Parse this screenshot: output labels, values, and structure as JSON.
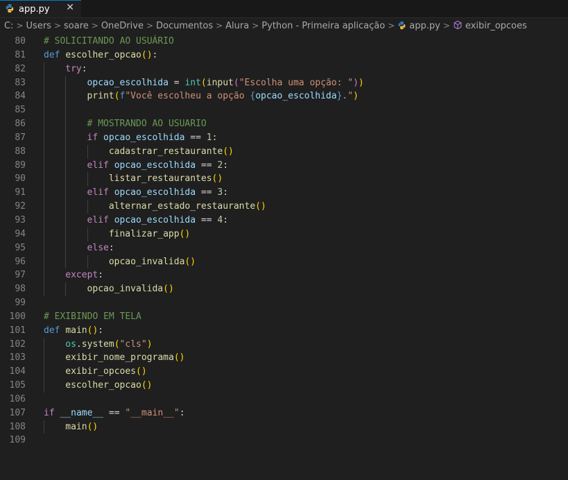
{
  "tab": {
    "filename": "app.py",
    "close_glyph": "✕"
  },
  "breadcrumb": {
    "segments": [
      "C:",
      "Users",
      "soare",
      "OneDrive",
      "Documentos",
      "Alura",
      "Python - Primeira aplicação",
      "app.py",
      "exibir_opcoes"
    ],
    "separator": ">"
  },
  "colors": {
    "comment": "#6a9955",
    "keyword": "#c586c0",
    "def": "#569cd6",
    "function": "#dcdcaa",
    "variable": "#9cdcfe",
    "string": "#ce9178",
    "number": "#b5cea8",
    "builtin": "#4ec9b0",
    "bracket1": "#ffd700",
    "bracket2": "#da70d6",
    "plain": "#d4d4d4"
  },
  "editor": {
    "lines": [
      {
        "n": "80",
        "indent": 0,
        "tokens": [
          [
            "cm",
            "# SOLICITANDO AO USUÁRIO"
          ]
        ]
      },
      {
        "n": "81",
        "indent": 0,
        "tokens": [
          [
            "kd",
            "def"
          ],
          [
            "pl",
            " "
          ],
          [
            "fn",
            "escolher_opcao"
          ],
          [
            "p1",
            "()"
          ],
          [
            "pl",
            ":"
          ]
        ]
      },
      {
        "n": "82",
        "indent": 1,
        "tokens": [
          [
            "kw",
            "try"
          ],
          [
            "pl",
            ":"
          ]
        ]
      },
      {
        "n": "83",
        "indent": 2,
        "tokens": [
          [
            "var",
            "opcao_escolhida"
          ],
          [
            "pl",
            " = "
          ],
          [
            "bi",
            "int"
          ],
          [
            "p1",
            "("
          ],
          [
            "fn",
            "input"
          ],
          [
            "p2",
            "("
          ],
          [
            "str",
            "\"Escolha uma opção: \""
          ],
          [
            "p2",
            ")"
          ],
          [
            "p1",
            ")"
          ]
        ]
      },
      {
        "n": "84",
        "indent": 2,
        "tokens": [
          [
            "fn",
            "print"
          ],
          [
            "p1",
            "("
          ],
          [
            "kd",
            "f"
          ],
          [
            "str",
            "\"Você escolheu a opção "
          ],
          [
            "kd",
            "{"
          ],
          [
            "var",
            "opcao_escolhida"
          ],
          [
            "kd",
            "}"
          ],
          [
            "str",
            ".\""
          ],
          [
            "p1",
            ")"
          ]
        ]
      },
      {
        "n": "85",
        "indent": 0,
        "tokens": []
      },
      {
        "n": "86",
        "indent": 2,
        "tokens": [
          [
            "cm",
            "# MOSTRANDO AO USUARIO"
          ]
        ]
      },
      {
        "n": "87",
        "indent": 2,
        "tokens": [
          [
            "kw",
            "if"
          ],
          [
            "pl",
            " "
          ],
          [
            "var",
            "opcao_escolhida"
          ],
          [
            "pl",
            " == "
          ],
          [
            "num",
            "1"
          ],
          [
            "pl",
            ":"
          ]
        ]
      },
      {
        "n": "88",
        "indent": 3,
        "tokens": [
          [
            "fn",
            "cadastrar_restaurante"
          ],
          [
            "p1",
            "()"
          ]
        ]
      },
      {
        "n": "89",
        "indent": 2,
        "tokens": [
          [
            "kw",
            "elif"
          ],
          [
            "pl",
            " "
          ],
          [
            "var",
            "opcao_escolhida"
          ],
          [
            "pl",
            " == "
          ],
          [
            "num",
            "2"
          ],
          [
            "pl",
            ":"
          ]
        ]
      },
      {
        "n": "90",
        "indent": 3,
        "tokens": [
          [
            "fn",
            "listar_restaurantes"
          ],
          [
            "p1",
            "()"
          ]
        ]
      },
      {
        "n": "91",
        "indent": 2,
        "tokens": [
          [
            "kw",
            "elif"
          ],
          [
            "pl",
            " "
          ],
          [
            "var",
            "opcao_escolhida"
          ],
          [
            "pl",
            " == "
          ],
          [
            "num",
            "3"
          ],
          [
            "pl",
            ":"
          ]
        ]
      },
      {
        "n": "92",
        "indent": 3,
        "tokens": [
          [
            "fn",
            "alternar_estado_restaurante"
          ],
          [
            "p1",
            "()"
          ]
        ]
      },
      {
        "n": "93",
        "indent": 2,
        "tokens": [
          [
            "kw",
            "elif"
          ],
          [
            "pl",
            " "
          ],
          [
            "var",
            "opcao_escolhida"
          ],
          [
            "pl",
            " == "
          ],
          [
            "num",
            "4"
          ],
          [
            "pl",
            ":"
          ]
        ]
      },
      {
        "n": "94",
        "indent": 3,
        "tokens": [
          [
            "fn",
            "finalizar_app"
          ],
          [
            "p1",
            "()"
          ]
        ]
      },
      {
        "n": "95",
        "indent": 2,
        "tokens": [
          [
            "kw",
            "else"
          ],
          [
            "pl",
            ":"
          ]
        ]
      },
      {
        "n": "96",
        "indent": 3,
        "tokens": [
          [
            "fn",
            "opcao_invalida"
          ],
          [
            "p1",
            "()"
          ]
        ]
      },
      {
        "n": "97",
        "indent": 1,
        "tokens": [
          [
            "kw",
            "except"
          ],
          [
            "pl",
            ":"
          ]
        ]
      },
      {
        "n": "98",
        "indent": 2,
        "tokens": [
          [
            "fn",
            "opcao_invalida"
          ],
          [
            "p1",
            "()"
          ]
        ]
      },
      {
        "n": "99",
        "indent": 0,
        "tokens": []
      },
      {
        "n": "100",
        "indent": 0,
        "tokens": [
          [
            "cm",
            "# EXIBINDO EM TELA"
          ]
        ]
      },
      {
        "n": "101",
        "indent": 0,
        "tokens": [
          [
            "kd",
            "def"
          ],
          [
            "pl",
            " "
          ],
          [
            "fn",
            "main"
          ],
          [
            "p1",
            "()"
          ],
          [
            "pl",
            ":"
          ]
        ]
      },
      {
        "n": "102",
        "indent": 1,
        "tokens": [
          [
            "bi",
            "os"
          ],
          [
            "pl",
            "."
          ],
          [
            "fn",
            "system"
          ],
          [
            "p1",
            "("
          ],
          [
            "str",
            "\"cls\""
          ],
          [
            "p1",
            ")"
          ]
        ]
      },
      {
        "n": "103",
        "indent": 1,
        "tokens": [
          [
            "fn",
            "exibir_nome_programa"
          ],
          [
            "p1",
            "()"
          ]
        ]
      },
      {
        "n": "104",
        "indent": 1,
        "tokens": [
          [
            "fn",
            "exibir_opcoes"
          ],
          [
            "p1",
            "()"
          ]
        ]
      },
      {
        "n": "105",
        "indent": 1,
        "tokens": [
          [
            "fn",
            "escolher_opcao"
          ],
          [
            "p1",
            "()"
          ]
        ]
      },
      {
        "n": "106",
        "indent": 0,
        "tokens": []
      },
      {
        "n": "107",
        "indent": 0,
        "tokens": [
          [
            "kw",
            "if"
          ],
          [
            "pl",
            " "
          ],
          [
            "var",
            "__name__"
          ],
          [
            "pl",
            " == "
          ],
          [
            "str",
            "\"__main__\""
          ],
          [
            "pl",
            ":"
          ]
        ]
      },
      {
        "n": "108",
        "indent": 1,
        "tokens": [
          [
            "fn",
            "main"
          ],
          [
            "p1",
            "()"
          ]
        ]
      },
      {
        "n": "109",
        "indent": 0,
        "tokens": []
      }
    ]
  }
}
